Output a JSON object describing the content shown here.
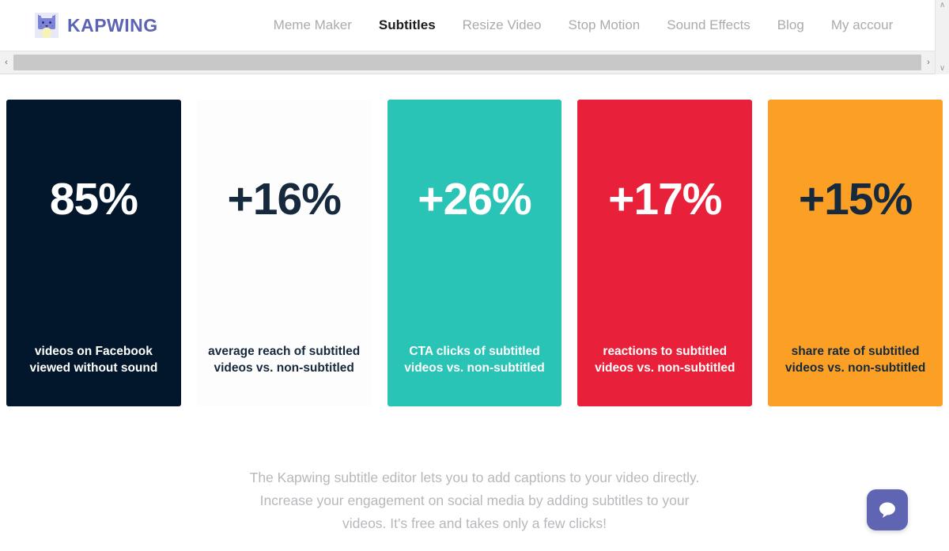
{
  "header": {
    "brand_name": "KAPWING",
    "brand_color": "#5c63b5",
    "logo_icon": "cat-face-logo-icon",
    "nav": [
      {
        "label": "Meme Maker",
        "active": false
      },
      {
        "label": "Subtitles",
        "active": true
      },
      {
        "label": "Resize Video",
        "active": false
      },
      {
        "label": "Stop Motion",
        "active": false
      },
      {
        "label": "Sound Effects",
        "active": false
      },
      {
        "label": "Blog",
        "active": false
      },
      {
        "label": "My accour",
        "active": false
      }
    ]
  },
  "scrollbars": {
    "vertical": {
      "up_arrow": "∧",
      "down_arrow": "∨"
    },
    "horizontal": {
      "left_arrow": "‹",
      "right_arrow": "›"
    }
  },
  "stats": [
    {
      "value": "85%",
      "caption": "videos on Facebook viewed without sound",
      "bg": "#02172b",
      "fg": "#ffffff"
    },
    {
      "value": "+16%",
      "caption": "average reach of subtitled videos vs. non-subtitled",
      "bg": "#fdfdfd",
      "fg": "#16293d"
    },
    {
      "value": "+26%",
      "caption": "CTA clicks of subtitled videos vs. non-subtitled",
      "bg": "#29c4b6",
      "fg": "#ffffff"
    },
    {
      "value": "+17%",
      "caption": "reactions to subtitled videos vs. non-subtitled",
      "bg": "#e82039",
      "fg": "#ffffff"
    },
    {
      "value": "+15%",
      "caption": "share rate of subtitled videos vs. non-subtitled",
      "bg": "#fba024",
      "fg": "#16293d"
    }
  ],
  "description": {
    "text": "The Kapwing subtitle editor lets you to add captions to your video directly. Increase your engagement on social media by adding subtitles to your videos. It's free and takes only a few clicks!",
    "color": "#b6b8bc"
  },
  "chat": {
    "icon": "chat-bubble-icon",
    "bg": "#5f65b3"
  }
}
